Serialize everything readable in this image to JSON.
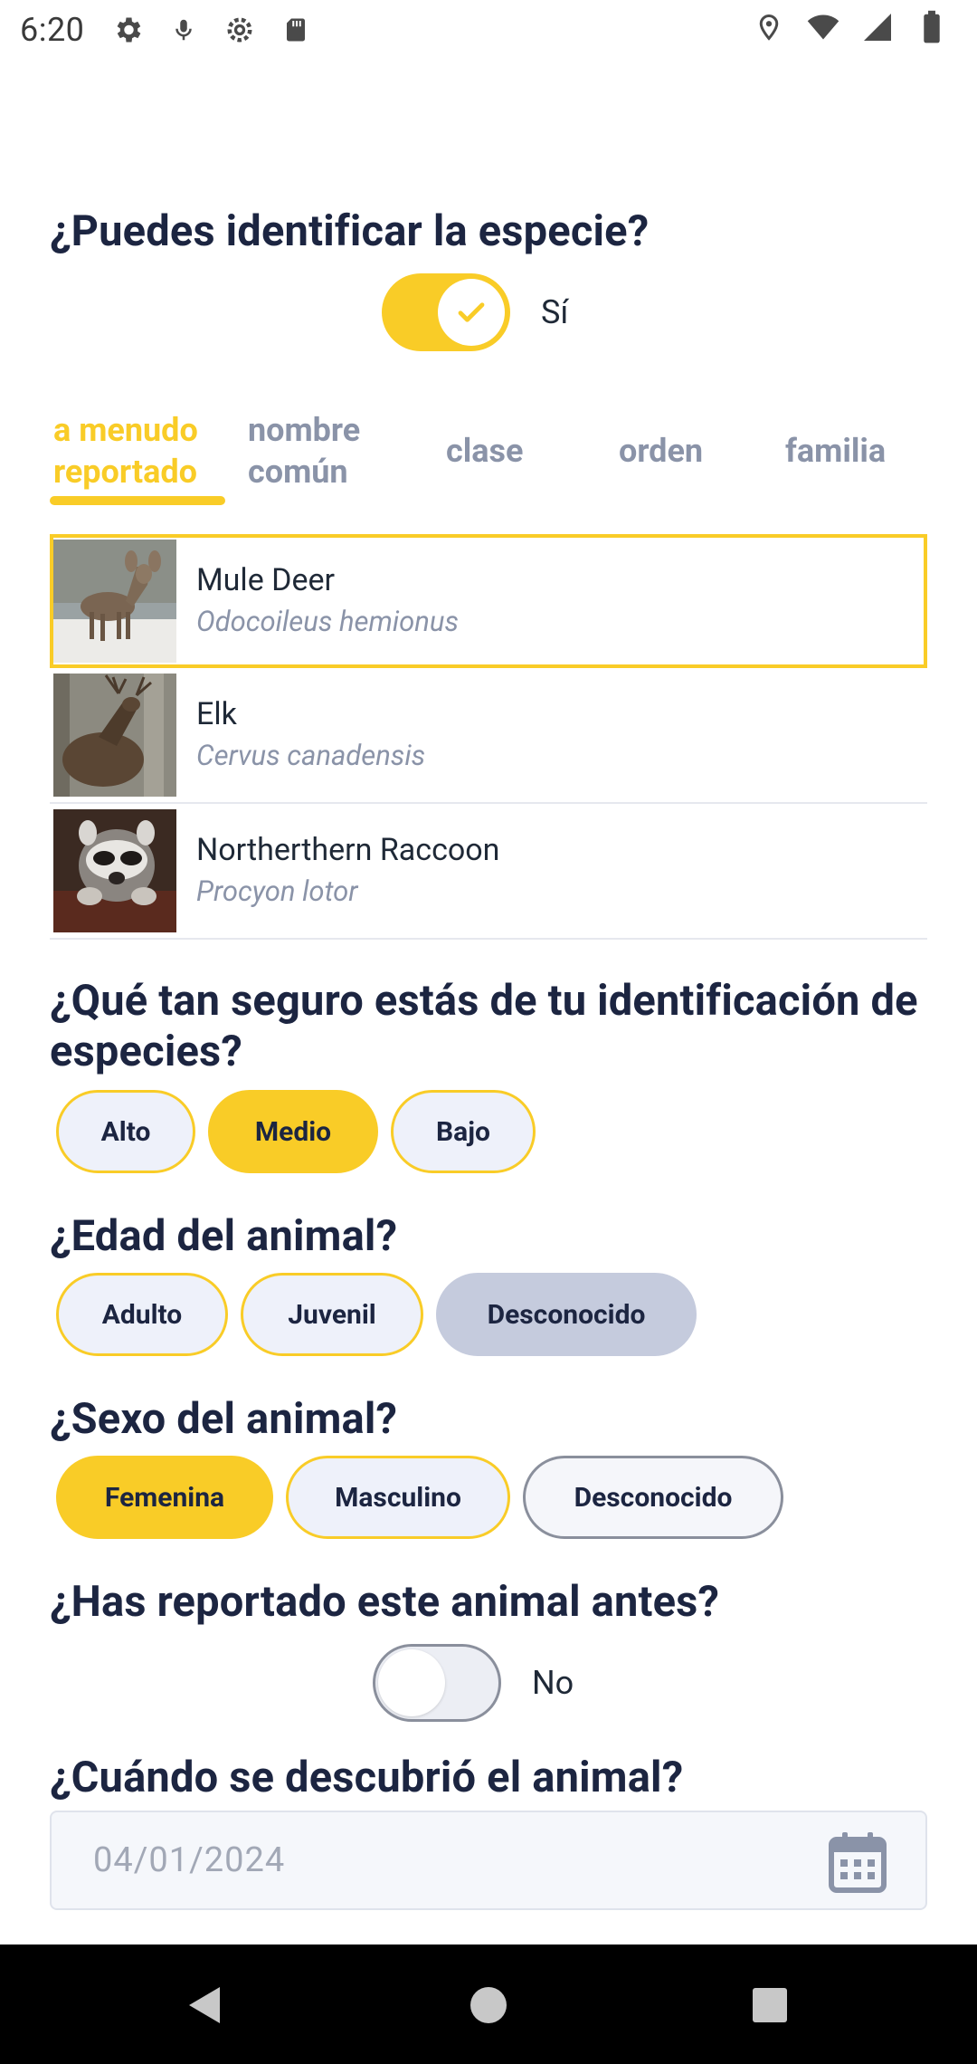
{
  "status_bar": {
    "time": "6:20",
    "left_icons": [
      "gear-icon",
      "mic-icon",
      "settings-icon",
      "sd-card-icon"
    ],
    "right_icons": [
      "location-icon",
      "wifi-icon",
      "signal-icon",
      "battery-icon"
    ]
  },
  "identify": {
    "question": "¿Puedes identificar la especie?",
    "toggle_on": true,
    "toggle_label": "Sí"
  },
  "tabs": [
    {
      "label_line1": "a menudo",
      "label_line2": "reportado",
      "active": true
    },
    {
      "label_line1": "nombre",
      "label_line2": "común",
      "active": false
    },
    {
      "label_line1": "clase",
      "label_line2": "",
      "active": false
    },
    {
      "label_line1": "orden",
      "label_line2": "",
      "active": false
    },
    {
      "label_line1": "familia",
      "label_line2": "",
      "active": false
    }
  ],
  "species": [
    {
      "common": "Mule Deer",
      "scientific": "Odocoileus hemionus",
      "selected": true
    },
    {
      "common": "Elk",
      "scientific": "Cervus canadensis",
      "selected": false
    },
    {
      "common": "Northerthern Raccoon",
      "scientific": "Procyon lotor",
      "selected": false
    }
  ],
  "confidence": {
    "question": "¿Qué tan seguro estás de tu identificación de especies?",
    "options": [
      "Alto",
      "Medio",
      "Bajo"
    ],
    "selected": "Medio"
  },
  "age": {
    "question": "¿Edad del animal?",
    "options": [
      "Adulto",
      "Juvenil",
      "Desconocido"
    ],
    "selected": "Desconocido"
  },
  "sex": {
    "question": "¿Sexo del animal?",
    "options": [
      "Femenina",
      "Masculino",
      "Desconocido"
    ],
    "selected": "Femenina"
  },
  "reported_before": {
    "question": "¿Has reportado este animal antes?",
    "toggle_on": false,
    "toggle_label": "No"
  },
  "discovered": {
    "question": "¿Cuándo se descubrió el animal?",
    "date_value": "04/01/2024"
  },
  "colors": {
    "accent": "#f9cc27",
    "heading": "#1c2541",
    "muted": "#8a93a8"
  }
}
